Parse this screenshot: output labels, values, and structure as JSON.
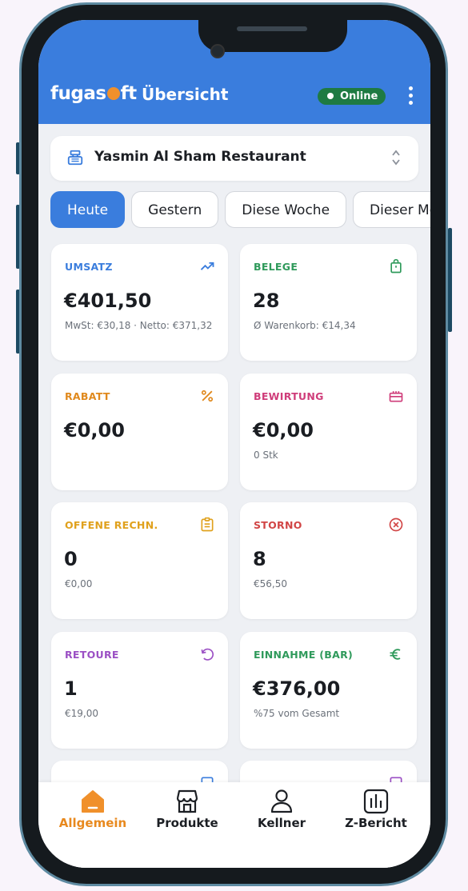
{
  "header": {
    "logo": {
      "part1": "fugas",
      "part2": "ft"
    },
    "title": "Übersicht",
    "status": "Online",
    "accent_color": "#3a7ddd"
  },
  "store": {
    "name": "Yasmin Al Sham Restaurant",
    "icon": "cash-register-icon"
  },
  "tabs": [
    {
      "label": "Heute",
      "active": true
    },
    {
      "label": "Gestern",
      "active": false
    },
    {
      "label": "Diese Woche",
      "active": false
    },
    {
      "label": "Dieser Monat",
      "active": false
    }
  ],
  "cards": {
    "umsatz": {
      "label": "UMSATZ",
      "value": "€401,50",
      "sub": "MwSt: €30,18 · Netto: €371,32",
      "color": "#3a7ddd",
      "icon": "trending-up-icon"
    },
    "belege": {
      "label": "BELEGE",
      "value": "28",
      "sub": "Ø Warenkorb: €14,34",
      "color": "#2f9a5b",
      "icon": "shopping-bag-icon"
    },
    "rabatt": {
      "label": "RABATT",
      "value": "€0,00",
      "sub": "",
      "color": "#e0891d",
      "icon": "percent-icon"
    },
    "bewirtung": {
      "label": "BEWIRTUNG",
      "value": "€0,00",
      "sub": "0 Stk",
      "color": "#cf3d7a",
      "icon": "gift-icon"
    },
    "offene": {
      "label": "OFFENE RECHN.",
      "value": "0",
      "sub": "€0,00",
      "color": "#e0a11d",
      "icon": "clipboard-icon"
    },
    "storno": {
      "label": "STORNO",
      "value": "8",
      "sub": "€56,50",
      "color": "#d14545",
      "icon": "cancel-circle-icon"
    },
    "retoure": {
      "label": "RETOURE",
      "value": "1",
      "sub": "€19,00",
      "color": "#9b4fc4",
      "icon": "undo-icon"
    },
    "einnahme": {
      "label": "EINNAHME (BAR)",
      "value": "€376,00",
      "sub": "%75 vom Gesamt",
      "color": "#2f9a5b",
      "icon": "euro-icon"
    }
  },
  "bottom_nav": [
    {
      "label": "Allgemein",
      "active": true,
      "icon": "home-icon"
    },
    {
      "label": "Produkte",
      "active": false,
      "icon": "store-icon"
    },
    {
      "label": "Kellner",
      "active": false,
      "icon": "person-icon"
    },
    {
      "label": "Z-Bericht",
      "active": false,
      "icon": "bar-chart-icon"
    }
  ]
}
